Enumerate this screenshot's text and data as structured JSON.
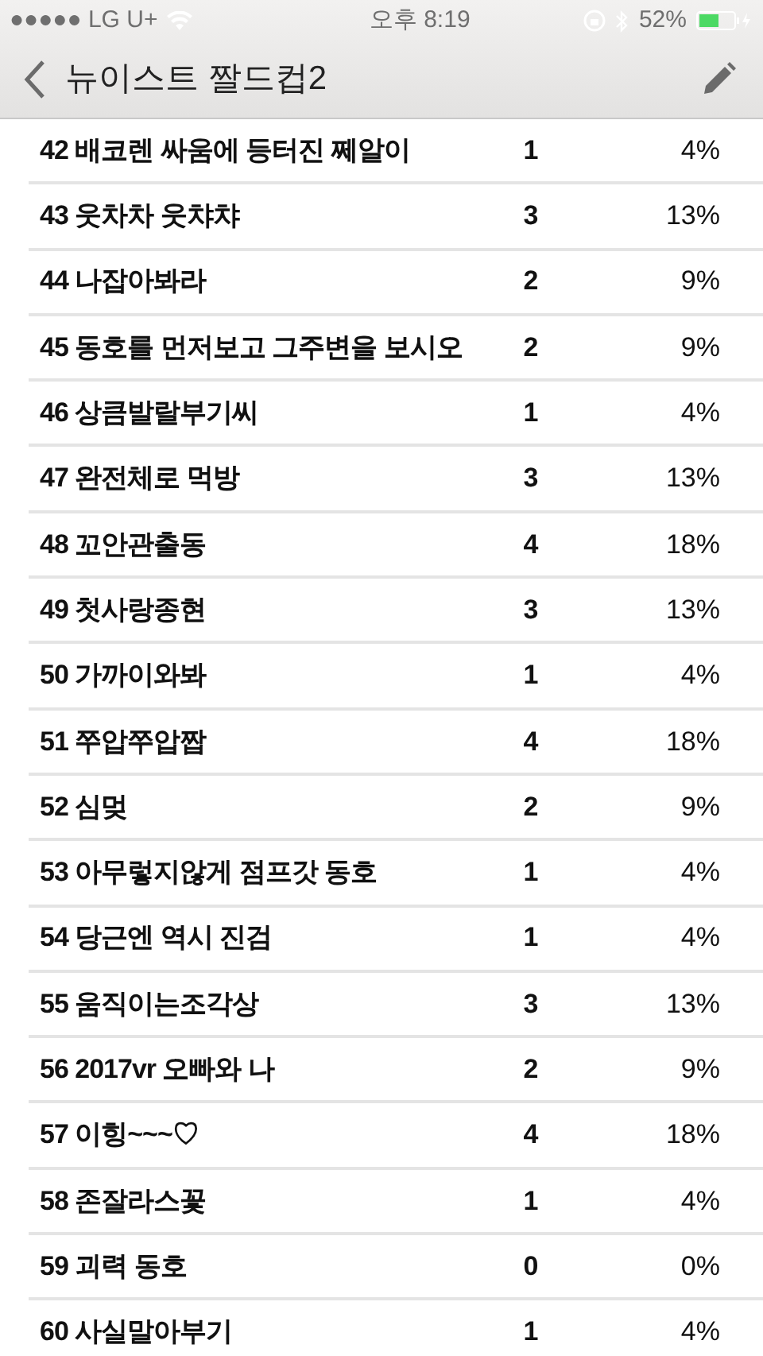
{
  "status_bar": {
    "carrier": "●●●●● LG U+",
    "time": "오후 8:19",
    "battery": "52%"
  },
  "nav": {
    "title": "뉴이스트 짤드컵2"
  },
  "rows": [
    {
      "name": "42 배코렌 싸움에 등터진 쩨알이",
      "count": "1",
      "percent": "4%"
    },
    {
      "name": "43 웃차차 웃챠챠",
      "count": "3",
      "percent": "13%"
    },
    {
      "name": "44 나잡아봐라",
      "count": "2",
      "percent": "9%"
    },
    {
      "name": "45 동호를 먼저보고 그주변을 보시오",
      "count": "2",
      "percent": "9%"
    },
    {
      "name": "46 상큼발랄부기씨",
      "count": "1",
      "percent": "4%"
    },
    {
      "name": "47 완전체로 먹방",
      "count": "3",
      "percent": "13%"
    },
    {
      "name": "48 꼬안관출동",
      "count": "4",
      "percent": "18%"
    },
    {
      "name": "49 첫사랑종현",
      "count": "3",
      "percent": "13%"
    },
    {
      "name": "50 가까이와봐",
      "count": "1",
      "percent": "4%"
    },
    {
      "name": "51 쭈압쭈압짭",
      "count": "4",
      "percent": "18%"
    },
    {
      "name": "52 심멎",
      "count": "2",
      "percent": "9%"
    },
    {
      "name": "53 아무렇지않게 점프갓 동호",
      "count": "1",
      "percent": "4%"
    },
    {
      "name": "54 당근엔 역시 진검",
      "count": "1",
      "percent": "4%"
    },
    {
      "name": "55 움직이는조각상",
      "count": "3",
      "percent": "13%"
    },
    {
      "name": "56 2017vr 오빠와 나",
      "count": "2",
      "percent": "9%"
    },
    {
      "name": "57 이힝~~~♡",
      "count": "4",
      "percent": "18%"
    },
    {
      "name": "58 존잘라스꽃",
      "count": "1",
      "percent": "4%"
    },
    {
      "name": "59 괴력 동호",
      "count": "0",
      "percent": "0%"
    },
    {
      "name": "60 사실말아부기",
      "count": "1",
      "percent": "4%"
    }
  ]
}
